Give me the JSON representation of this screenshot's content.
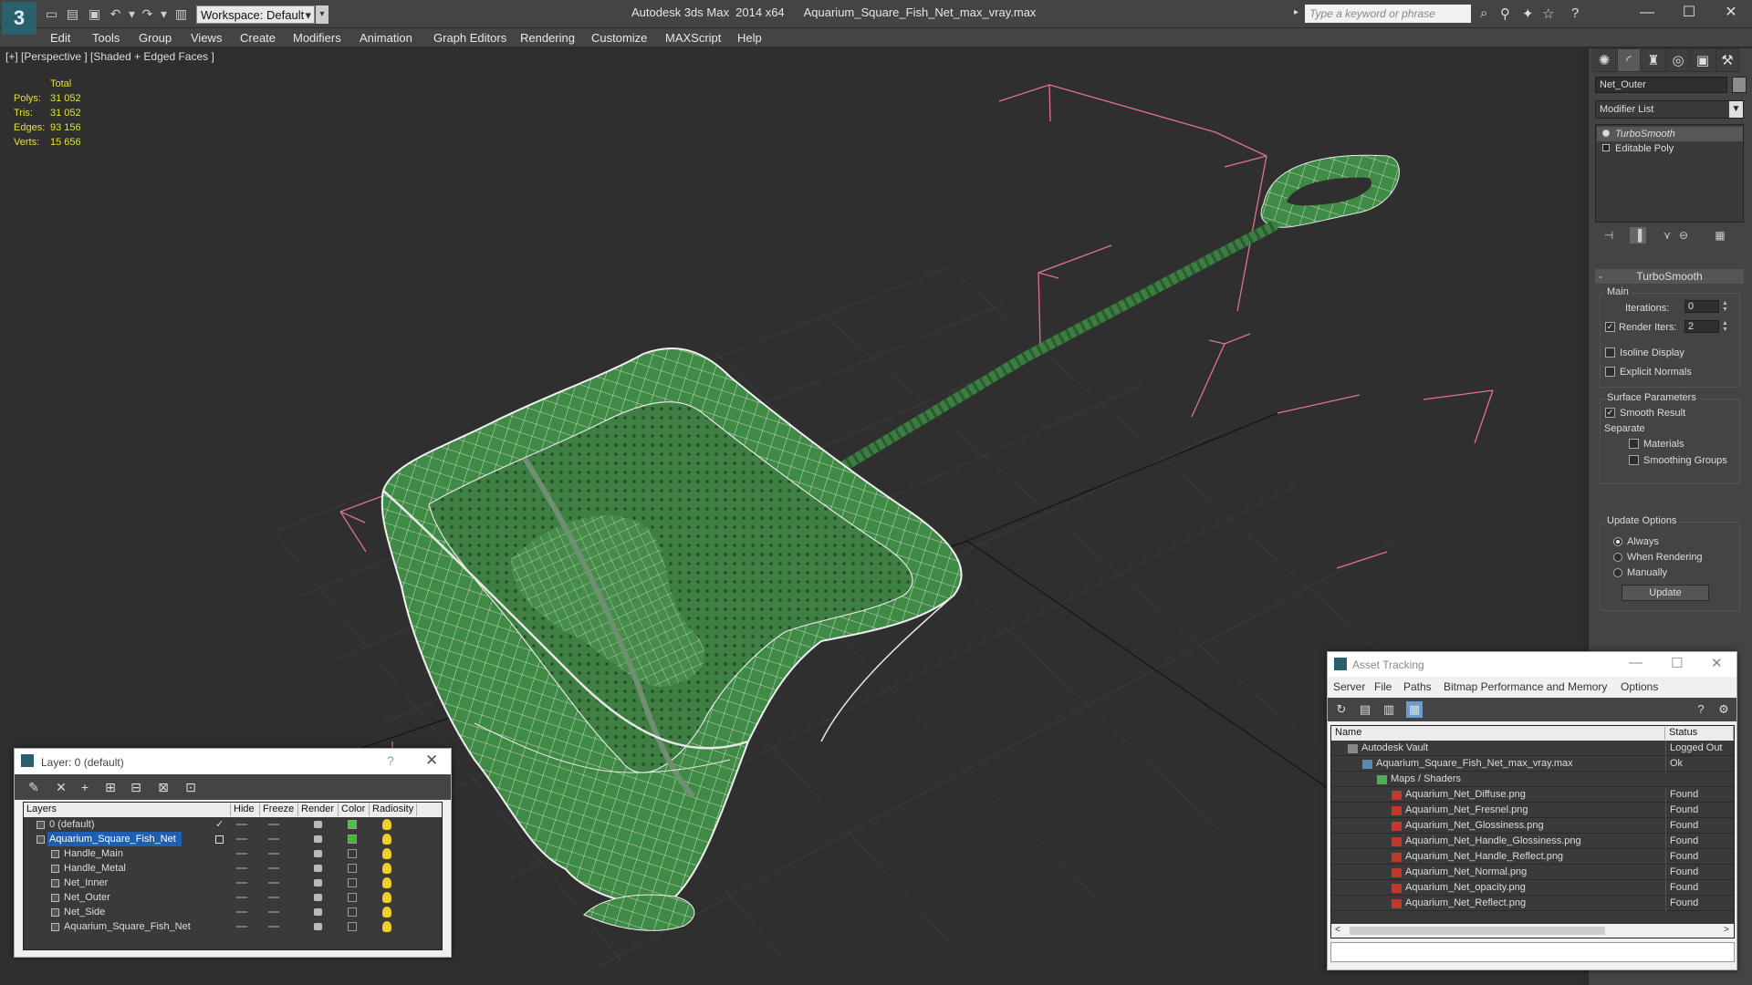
{
  "app": {
    "title": "Autodesk 3ds Max  2014 x64      Aquarium_Square_Fish_Net_max_vray.max",
    "workspace": "Workspace: Default",
    "search_placeholder": "Type a keyword or phrase",
    "logo": "3"
  },
  "menu": [
    "Edit",
    "Tools",
    "Group",
    "Views",
    "Create",
    "Modifiers",
    "Animation",
    "Graph Editors",
    "Rendering",
    "Customize",
    "MAXScript",
    "Help"
  ],
  "viewport": {
    "label": "[+] [Perspective ] [Shaded + Edged Faces ]",
    "stats": {
      "header": "Total",
      "rows": [
        {
          "label": "Polys:",
          "value": "31 052"
        },
        {
          "label": "Tris:",
          "value": "31 052"
        },
        {
          "label": "Edges:",
          "value": "93 156"
        },
        {
          "label": "Verts:",
          "value": "15 656"
        }
      ]
    }
  },
  "command_panel": {
    "object_name": "Net_Outer",
    "modifier_list": "Modifier List",
    "stack": [
      "TurboSmooth",
      "Editable Poly"
    ],
    "rollout": "TurboSmooth",
    "main": {
      "title": "Main",
      "iterations_label": "Iterations:",
      "iterations_value": "0",
      "render_iters_label": "Render Iters:",
      "render_iters_value": "2",
      "isoline": "Isoline Display",
      "explicit": "Explicit Normals"
    },
    "surface": {
      "title": "Surface Parameters",
      "smooth_result": "Smooth Result",
      "separate": "Separate",
      "materials": "Materials",
      "smoothing_groups": "Smoothing Groups"
    },
    "update": {
      "title": "Update Options",
      "always": "Always",
      "when_rendering": "When Rendering",
      "manually": "Manually",
      "button": "Update"
    }
  },
  "layer_window": {
    "title": "Layer: 0 (default)",
    "help": "?",
    "columns": [
      "Layers",
      "Hide",
      "Freeze",
      "Render",
      "Color",
      "Radiosity"
    ],
    "rows": [
      {
        "name": "0 (default)",
        "color": "#46c83a",
        "level": 0
      },
      {
        "name": "Aquarium_Square_Fish_Net",
        "color": "#3cbf2e",
        "level": 0
      },
      {
        "name": "Handle_Main",
        "color": "#3a3a3a",
        "level": 1
      },
      {
        "name": "Handle_Metal",
        "color": "#3a3a3a",
        "level": 1
      },
      {
        "name": "Net_Inner",
        "color": "#3a3a3a",
        "level": 1
      },
      {
        "name": "Net_Outer",
        "color": "#3a3a3a",
        "level": 1
      },
      {
        "name": "Net_Side",
        "color": "#3a3a3a",
        "level": 1
      },
      {
        "name": "Aquarium_Square_Fish_Net",
        "color": "#3a3a3a",
        "level": 1
      }
    ]
  },
  "asset_window": {
    "title": "Asset Tracking",
    "menu": [
      "Server",
      "File",
      "Paths",
      "Bitmap Performance and Memory",
      "Options"
    ],
    "columns": [
      "Name",
      "Status"
    ],
    "rows": [
      {
        "name": "Autodesk Vault",
        "status": "Logged Out",
        "level": 0,
        "icon": "vault-icon"
      },
      {
        "name": "Aquarium_Square_Fish_Net_max_vray.max",
        "status": "Ok",
        "level": 1,
        "icon": "max-file-icon"
      },
      {
        "name": "Maps / Shaders",
        "status": "",
        "level": 2,
        "icon": "maps-icon"
      },
      {
        "name": "Aquarium_Net_Diffuse.png",
        "status": "Found",
        "level": 3,
        "icon": "png-icon"
      },
      {
        "name": "Aquarium_Net_Fresnel.png",
        "status": "Found",
        "level": 3,
        "icon": "png-icon"
      },
      {
        "name": "Aquarium_Net_Glossiness.png",
        "status": "Found",
        "level": 3,
        "icon": "png-icon"
      },
      {
        "name": "Aquarium_Net_Handle_Glossiness.png",
        "status": "Found",
        "level": 3,
        "icon": "png-icon"
      },
      {
        "name": "Aquarium_Net_Handle_Reflect.png",
        "status": "Found",
        "level": 3,
        "icon": "png-icon"
      },
      {
        "name": "Aquarium_Net_Normal.png",
        "status": "Found",
        "level": 3,
        "icon": "png-icon"
      },
      {
        "name": "Aquarium_Net_opacity.png",
        "status": "Found",
        "level": 3,
        "icon": "png-icon"
      },
      {
        "name": "Aquarium_Net_Reflect.png",
        "status": "Found",
        "level": 3,
        "icon": "png-icon"
      }
    ]
  },
  "colors": {
    "mesh_green": "#3f8a44",
    "wire": "#ffffff",
    "bbox": "#e0728c",
    "stats": "#e6e037",
    "selection": "#1f5fb2"
  }
}
